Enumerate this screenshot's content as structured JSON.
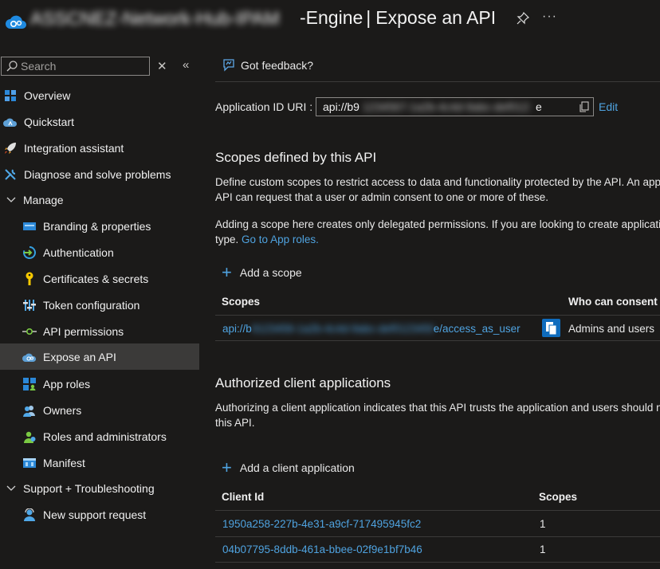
{
  "header": {
    "app_name_obscured": "ASSCNEZ-Network-Hub-IPAM",
    "app_name_suffix": "-Engine",
    "separator": "|",
    "page_title": "Expose an API",
    "more_label": "···"
  },
  "sidebar": {
    "search_placeholder": "Search",
    "collapse_x": "✕",
    "collapse_chevron": "«",
    "items": [
      {
        "label": "Overview",
        "icon": "overview-grid-icon"
      },
      {
        "label": "Quickstart",
        "icon": "quickstart-cloud-icon"
      },
      {
        "label": "Integration assistant",
        "icon": "rocket-icon"
      },
      {
        "label": "Diagnose and solve problems",
        "icon": "wrench-icon"
      },
      {
        "label": "Manage",
        "icon": "chevron-down-icon"
      },
      {
        "label": "Branding & properties",
        "icon": "branding-icon"
      },
      {
        "label": "Authentication",
        "icon": "authentication-icon"
      },
      {
        "label": "Certificates & secrets",
        "icon": "key-icon"
      },
      {
        "label": "Token configuration",
        "icon": "token-config-icon"
      },
      {
        "label": "API permissions",
        "icon": "api-permissions-icon"
      },
      {
        "label": "Expose an API",
        "icon": "expose-api-icon"
      },
      {
        "label": "App roles",
        "icon": "app-roles-icon"
      },
      {
        "label": "Owners",
        "icon": "owners-icon"
      },
      {
        "label": "Roles and administrators",
        "icon": "roles-admins-icon"
      },
      {
        "label": "Manifest",
        "icon": "manifest-icon"
      },
      {
        "label": "Support + Troubleshooting",
        "icon": "chevron-down-icon"
      },
      {
        "label": "New support request",
        "icon": "support-person-icon"
      }
    ]
  },
  "main": {
    "feedback_label": "Got feedback?",
    "app_id": {
      "label": "Application ID URI :",
      "value_prefix": "api://b9",
      "value_obscured": "1234567-1a2b-4c4d-9abc-def0123456789",
      "value_suffix": "e",
      "edit_label": "Edit"
    },
    "scopes": {
      "title": "Scopes defined by this API",
      "desc_line1": "Define custom scopes to restrict access to data and functionality protected by the API. An applicat",
      "desc_line2": "API can request that a user or admin consent to one or more of these.",
      "note_line1": "Adding a scope here creates only delegated permissions. If you are looking to create application-o",
      "note_line2_prefix": "type.",
      "note_line2_link": "Go to App roles.",
      "add_label": "Add a scope",
      "col_scopes": "Scopes",
      "col_consent": "Who can consent",
      "rows": [
        {
          "scope_prefix": "api://b",
          "scope_obscured": "9123456-1a2b-4c4d-9abc-def012345678",
          "scope_suffix": "e/access_as_user",
          "consent": "Admins and users"
        }
      ]
    },
    "clients": {
      "title": "Authorized client applications",
      "desc_line1": "Authorizing a client application indicates that this API trusts the application and users should not",
      "desc_line2": "this API.",
      "add_label": "Add a client application",
      "col_client": "Client Id",
      "col_scopes": "Scopes",
      "rows": [
        {
          "client_id": "1950a258-227b-4e31-a9cf-717495945fc2",
          "scopes": "1"
        },
        {
          "client_id": "04b07795-8ddb-461a-bbee-02f9e1bf7b46",
          "scopes": "1"
        }
      ]
    }
  },
  "colors": {
    "background": "#1b1a19",
    "link": "#4fa3e0",
    "active_nav": "#3b3a39",
    "accent": "#0f6cbd"
  }
}
